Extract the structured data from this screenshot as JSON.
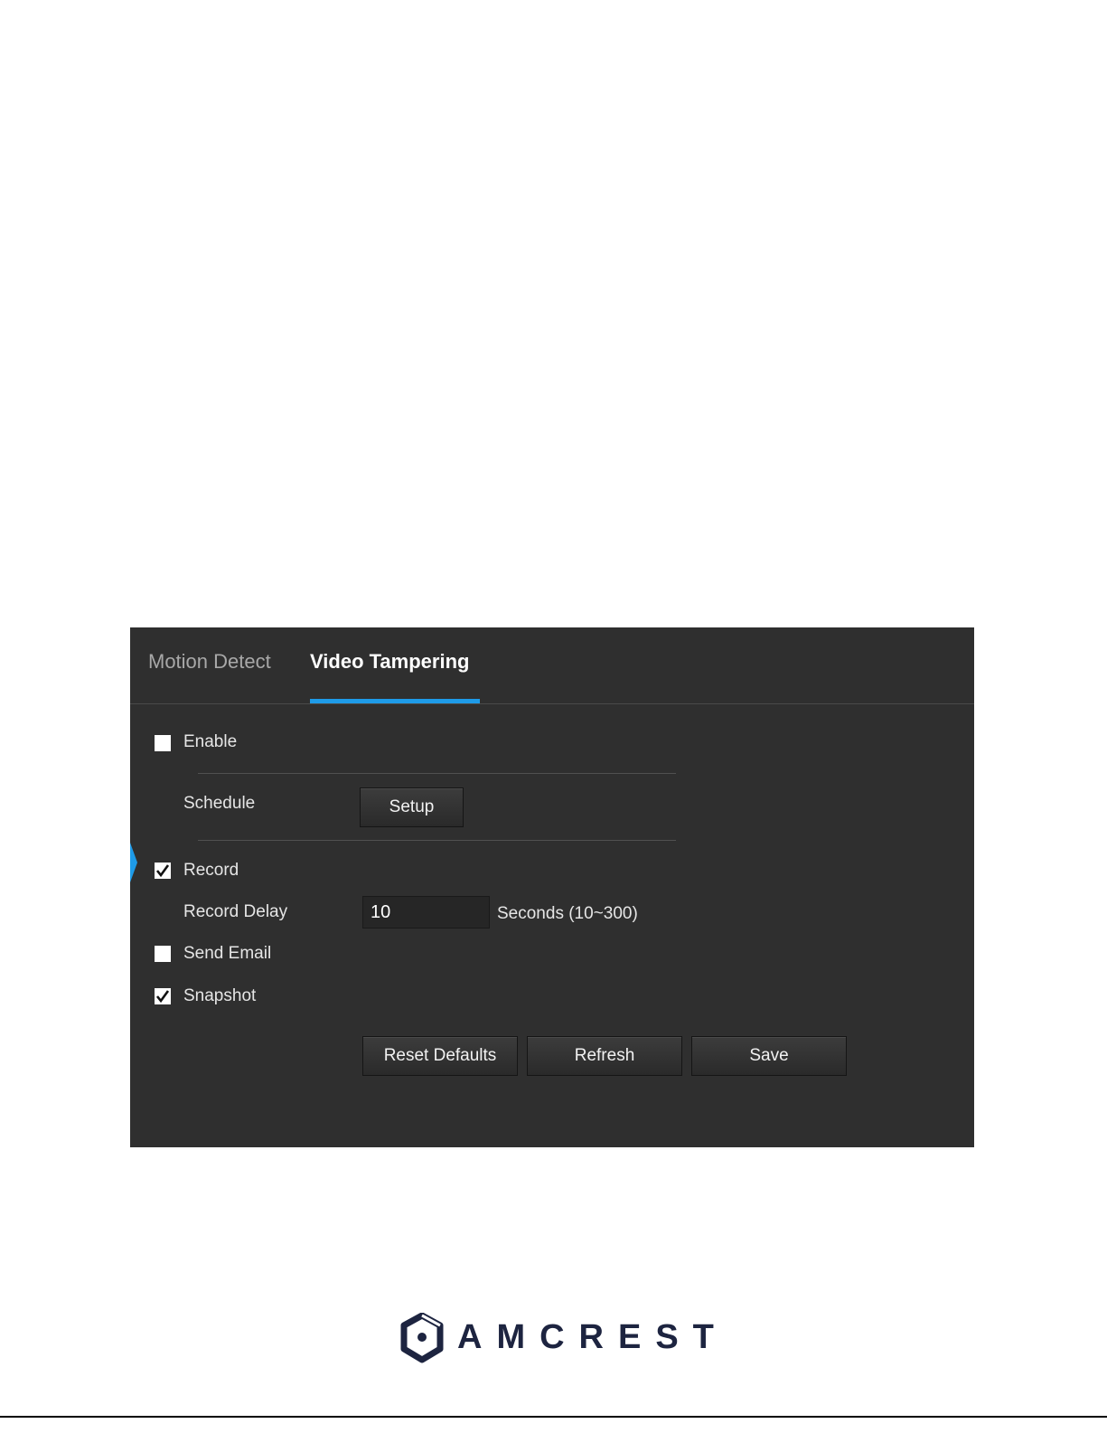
{
  "tabs": [
    {
      "label": "Motion Detect",
      "active": false
    },
    {
      "label": "Video Tampering",
      "active": true
    }
  ],
  "form": {
    "enable": {
      "label": "Enable",
      "checked": false
    },
    "schedule": {
      "label": "Schedule",
      "button": "Setup"
    },
    "record": {
      "label": "Record",
      "checked": true
    },
    "record_delay": {
      "label": "Record Delay",
      "value": "10",
      "unit": "Seconds (10~300)"
    },
    "send_email": {
      "label": "Send Email",
      "checked": false
    },
    "snapshot": {
      "label": "Snapshot",
      "checked": true
    }
  },
  "actions": {
    "reset": "Reset Defaults",
    "refresh": "Refresh",
    "save": "Save"
  },
  "footer": {
    "logo_text": "AMCREST"
  },
  "colors": {
    "accent": "#1e9be8",
    "panel_bg": "#2f2f2f",
    "brand": "#1d2440"
  }
}
